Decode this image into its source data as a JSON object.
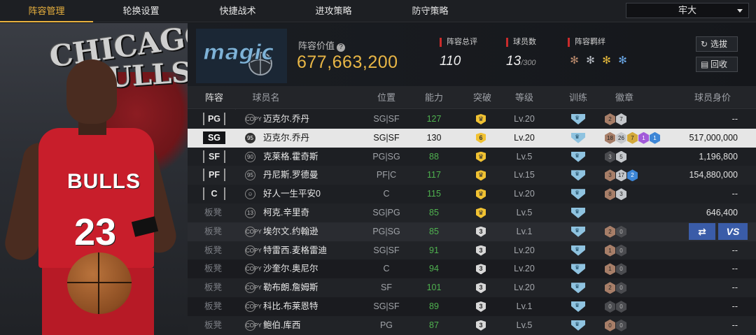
{
  "nav": {
    "tabs": [
      {
        "label": "阵容管理",
        "active": true
      },
      {
        "label": "轮换设置",
        "active": false
      },
      {
        "label": "快捷战术",
        "active": false
      },
      {
        "label": "进攻策略",
        "active": false
      },
      {
        "label": "防守策略",
        "active": false
      }
    ],
    "team_select": "牢大"
  },
  "hero": {
    "logo_line1": "CHICAGO",
    "logo_line2": "BULLS",
    "jersey_name": "BULLS",
    "jersey_number": "23"
  },
  "header": {
    "team_logo_text": "magic",
    "value_label": "阵容价值",
    "value": "677,663,200",
    "stats": [
      {
        "label": "阵容总评",
        "value": "110",
        "suffix": ""
      },
      {
        "label": "球员数",
        "value": "13",
        "suffix": "/300"
      },
      {
        "label": "阵容羁绊",
        "value": "",
        "suffix": ""
      }
    ],
    "bond_icons": [
      "bond-icon-1",
      "bond-icon-2",
      "bond-icon-3",
      "bond-icon-4"
    ],
    "buttons": {
      "pick": "选拔",
      "recycle": "回收"
    }
  },
  "table": {
    "headers": [
      "阵容",
      "球员名",
      "位置",
      "能力",
      "突破",
      "等级",
      "训练",
      "徽章",
      "球员身价"
    ],
    "rows": [
      {
        "slot": "PG",
        "type": "starter",
        "icon": "COPY",
        "name": "迈克尔.乔丹",
        "pos": "SG|SF",
        "ability": "127",
        "break": "",
        "level": "Lv.20",
        "badges": [
          {
            "c": "bronze",
            "v": "2"
          },
          {
            "c": "silver",
            "v": "7"
          }
        ],
        "worth": "--",
        "highlight": false,
        "selected": false
      },
      {
        "slot": "SG",
        "type": "starter",
        "icon": "95",
        "name": "迈克尔.乔丹",
        "pos": "SG|SF",
        "ability": "130",
        "break": "6",
        "level": "Lv.20",
        "badges": [
          {
            "c": "bronze",
            "v": "18"
          },
          {
            "c": "silver",
            "v": "26"
          },
          {
            "c": "gold",
            "v": "7"
          },
          {
            "c": "purple",
            "v": "1"
          },
          {
            "c": "blue",
            "v": "1"
          }
        ],
        "worth": "517,000,000",
        "highlight": false,
        "selected": true
      },
      {
        "slot": "SF",
        "type": "starter",
        "icon": "90",
        "name": "克莱格.霍奇斯",
        "pos": "PG|SG",
        "ability": "88",
        "break": "",
        "level": "Lv.5",
        "badges": [
          {
            "c": "dark",
            "v": "3"
          },
          {
            "c": "silver",
            "v": "5"
          }
        ],
        "worth": "1,196,800",
        "highlight": false,
        "selected": false
      },
      {
        "slot": "PF",
        "type": "starter",
        "icon": "95",
        "name": "丹尼斯.罗德曼",
        "pos": "PF|C",
        "ability": "117",
        "break": "",
        "level": "Lv.15",
        "badges": [
          {
            "c": "bronze",
            "v": "3"
          },
          {
            "c": "silver",
            "v": "17"
          },
          {
            "c": "blue",
            "v": "2"
          }
        ],
        "worth": "154,880,000",
        "highlight": false,
        "selected": false
      },
      {
        "slot": "C",
        "type": "starter",
        "icon": "avatar",
        "name": "好人一生平安0",
        "pos": "C",
        "ability": "115",
        "break": "",
        "level": "Lv.20",
        "badges": [
          {
            "c": "bronze",
            "v": "8"
          },
          {
            "c": "silver",
            "v": "3"
          }
        ],
        "worth": "--",
        "highlight": false,
        "selected": false
      },
      {
        "slot": "板凳",
        "type": "bench",
        "icon": "13",
        "name": "柯克.辛里奇",
        "pos": "SG|PG",
        "ability": "85",
        "break": "",
        "level": "Lv.5",
        "badges": [],
        "worth": "646,400",
        "highlight": false,
        "selected": false
      },
      {
        "slot": "板凳",
        "type": "bench",
        "icon": "COPY",
        "name": "埃尔文.约翰逊",
        "pos": "PG|SG",
        "ability": "85",
        "break": "3",
        "level": "Lv.1",
        "badges": [
          {
            "c": "bronze",
            "v": "2"
          },
          {
            "c": "dark",
            "v": "0"
          }
        ],
        "worth": "",
        "highlight": true,
        "selected": false
      },
      {
        "slot": "板凳",
        "type": "bench",
        "icon": "COPY",
        "name": "特雷西.麦格雷迪",
        "pos": "SG|SF",
        "ability": "91",
        "break": "3",
        "level": "Lv.20",
        "badges": [
          {
            "c": "bronze",
            "v": "1"
          },
          {
            "c": "dark",
            "v": "0"
          }
        ],
        "worth": "--",
        "highlight": false,
        "selected": false
      },
      {
        "slot": "板凳",
        "type": "bench",
        "icon": "COPY",
        "name": "沙奎尔.奥尼尔",
        "pos": "C",
        "ability": "94",
        "break": "3",
        "level": "Lv.20",
        "badges": [
          {
            "c": "bronze",
            "v": "1"
          },
          {
            "c": "dark",
            "v": "0"
          }
        ],
        "worth": "--",
        "highlight": false,
        "selected": false
      },
      {
        "slot": "板凳",
        "type": "bench",
        "icon": "COPY",
        "name": "勒布朗.詹姆斯",
        "pos": "SF",
        "ability": "101",
        "break": "3",
        "level": "Lv.20",
        "badges": [
          {
            "c": "bronze",
            "v": "2"
          },
          {
            "c": "dark",
            "v": "0"
          }
        ],
        "worth": "--",
        "highlight": false,
        "selected": false
      },
      {
        "slot": "板凳",
        "type": "bench",
        "icon": "COPY",
        "name": "科比.布莱恩特",
        "pos": "SG|SF",
        "ability": "89",
        "break": "3",
        "level": "Lv.1",
        "badges": [
          {
            "c": "dark",
            "v": "0"
          },
          {
            "c": "dark",
            "v": "0"
          }
        ],
        "worth": "--",
        "highlight": false,
        "selected": false
      },
      {
        "slot": "板凳",
        "type": "bench",
        "icon": "COPY",
        "name": "鲍伯.库西",
        "pos": "PG",
        "ability": "87",
        "break": "3",
        "level": "Lv.5",
        "badges": [
          {
            "c": "bronze",
            "v": "0"
          },
          {
            "c": "dark",
            "v": "0"
          }
        ],
        "worth": "--",
        "highlight": false,
        "selected": false
      }
    ],
    "row_actions": {
      "swap": "⇄",
      "vs": "VS"
    }
  },
  "colors": {
    "accent": "#e9b13e",
    "value": "#e8b646",
    "ability": "#4fb24f",
    "stat_marker": "#c92b2b",
    "action_blue": "#3a5ca8"
  }
}
